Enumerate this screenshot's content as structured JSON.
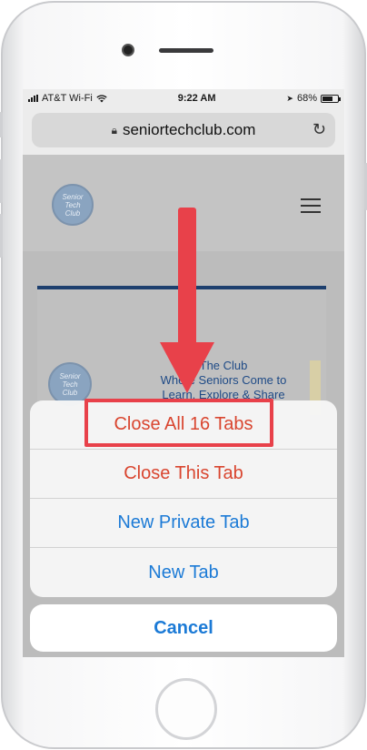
{
  "status_bar": {
    "carrier": "AT&T Wi-Fi",
    "time": "9:22 AM",
    "battery_percent": "68%",
    "battery_level": 0.68
  },
  "address_bar": {
    "url": "seniortechclub.com"
  },
  "site": {
    "logo_line1": "Senior",
    "logo_line2": "Tech",
    "logo_line3": "Club",
    "card_text_line1": "The Club",
    "card_text_line2": "Where Seniors Come to",
    "card_text_line3": "Learn, Explore & Share"
  },
  "action_sheet": {
    "items": [
      {
        "label": "Close All 16 Tabs"
      },
      {
        "label": "Close This Tab"
      },
      {
        "label": "New Private Tab"
      },
      {
        "label": "New Tab"
      }
    ],
    "cancel_label": "Cancel"
  },
  "colors": {
    "destructive": "#d9452f",
    "action_blue": "#1b7ad6",
    "annotation_red": "#e8414a"
  }
}
